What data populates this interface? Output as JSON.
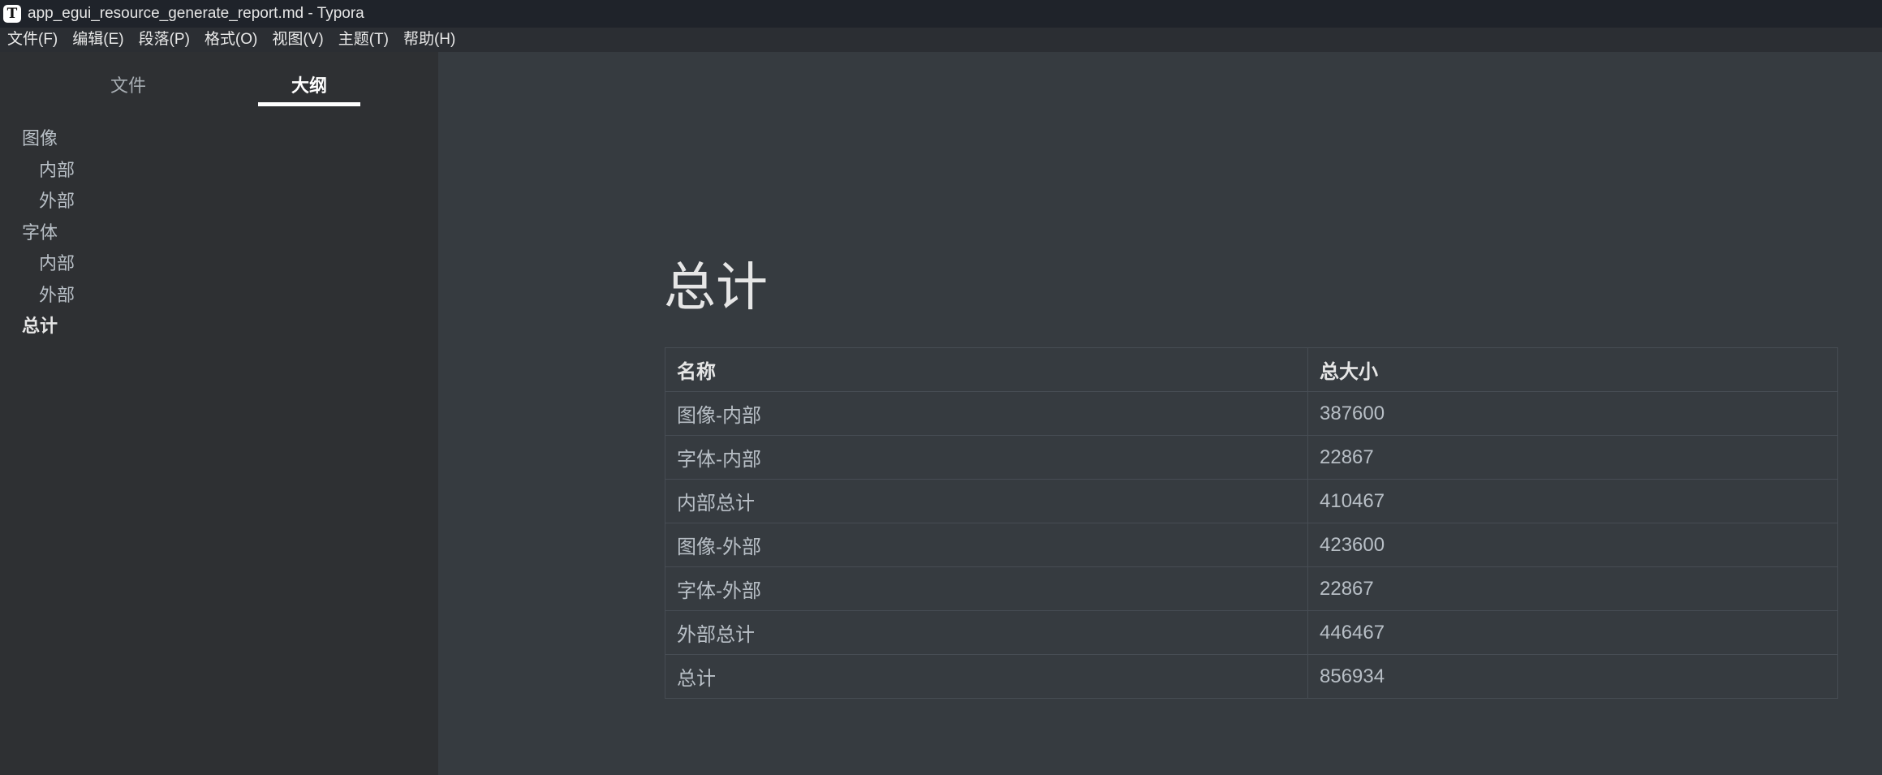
{
  "window": {
    "title": "app_egui_resource_generate_report.md - Typora",
    "app_icon": "T"
  },
  "menu": [
    "文件(F)",
    "编辑(E)",
    "段落(P)",
    "格式(O)",
    "视图(V)",
    "主题(T)",
    "帮助(H)"
  ],
  "sidebar": {
    "tabs": {
      "files": "文件",
      "outline": "大纲"
    },
    "outline": [
      {
        "label": "图像",
        "level": 1
      },
      {
        "label": "内部",
        "level": 2
      },
      {
        "label": "外部",
        "level": 2
      },
      {
        "label": "字体",
        "level": 1
      },
      {
        "label": "内部",
        "level": 2
      },
      {
        "label": "外部",
        "level": 2
      },
      {
        "label": "总计",
        "level": 1,
        "active": true
      }
    ]
  },
  "document": {
    "heading": "总计",
    "table": {
      "headers": [
        "名称",
        "总大小"
      ],
      "rows": [
        [
          "图像-内部",
          "387600"
        ],
        [
          "字体-内部",
          "22867"
        ],
        [
          "内部总计",
          "410467"
        ],
        [
          "图像-外部",
          "423600"
        ],
        [
          "字体-外部",
          "22867"
        ],
        [
          "外部总计",
          "446467"
        ],
        [
          "总计",
          "856934"
        ]
      ]
    }
  }
}
